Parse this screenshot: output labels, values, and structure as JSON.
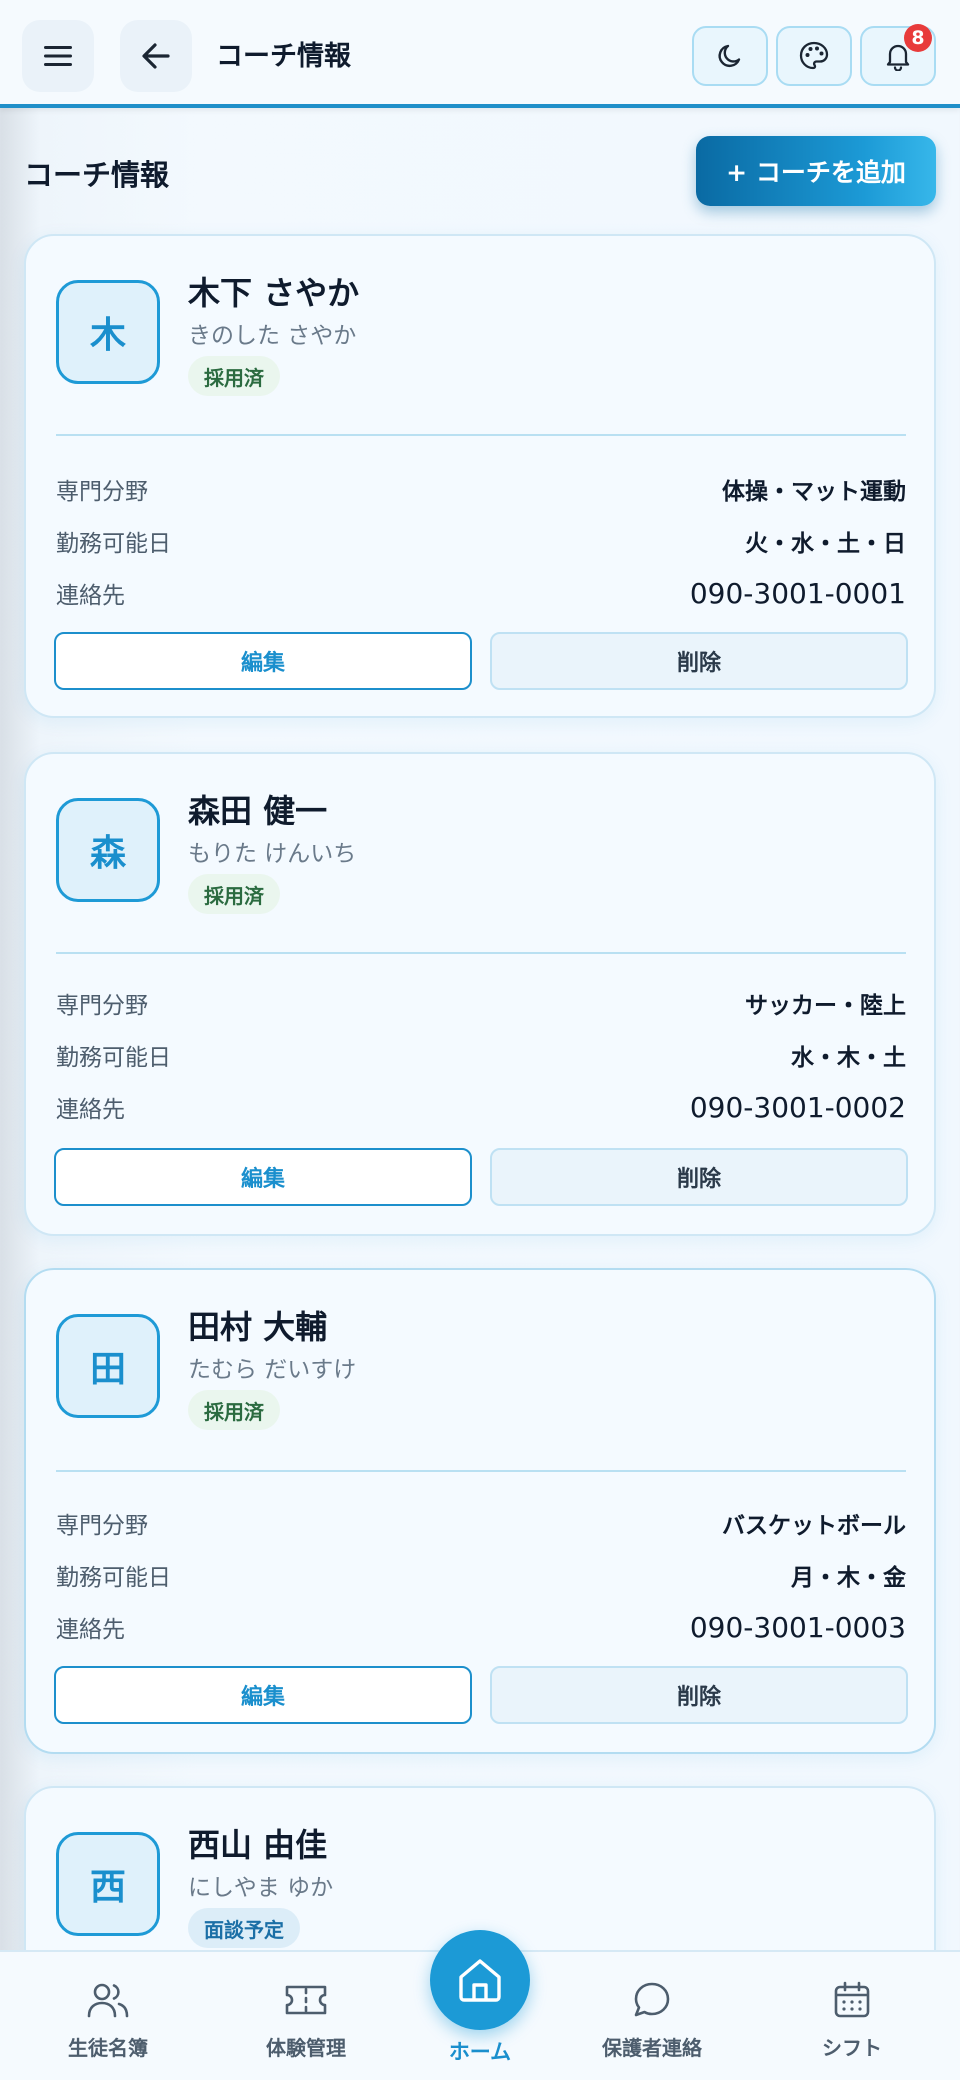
{
  "header": {
    "title": "コーチ情報",
    "notification_count": "8",
    "icons": [
      "menu-icon",
      "back-arrow-icon",
      "moon-icon",
      "palette-icon",
      "bell-icon"
    ]
  },
  "page": {
    "title": "コーチ情報",
    "add_button": "+ コーチを追加"
  },
  "field_labels": {
    "specialty": "専門分野",
    "availability": "勤務可能日",
    "contact": "連絡先"
  },
  "actions": {
    "edit": "編集",
    "delete": "削除"
  },
  "coaches": [
    {
      "initial": "木",
      "name": "木下 さやか",
      "kana": "きのした さやか",
      "status": "採用済",
      "specialty": "体操・マット運動",
      "availability": "火・水・土・日",
      "contact": "090-3001-0001"
    },
    {
      "initial": "森",
      "name": "森田 健一",
      "kana": "もりた けんいち",
      "status": "採用済",
      "specialty": "サッカー・陸上",
      "availability": "水・木・土",
      "contact": "090-3001-0002"
    },
    {
      "initial": "田",
      "name": "田村 大輔",
      "kana": "たむら だいすけ",
      "status": "採用済",
      "specialty": "バスケットボール",
      "availability": "月・木・金",
      "contact": "090-3001-0003"
    },
    {
      "initial": "西",
      "name": "西山 由佳",
      "kana": "にしやま ゆか",
      "status": "面談予定"
    }
  ],
  "bottom_nav": {
    "students": "生徒名簿",
    "trial": "体験管理",
    "home": "ホーム",
    "parents": "保護者連絡",
    "shift": "シフト"
  },
  "colors": {
    "accent": "#1c9ad6",
    "accent_dark": "#0a6aa3",
    "badge": "#e83b3b",
    "status_hired_bg": "#eaf6ee",
    "status_interview_bg": "#dcedf8"
  }
}
